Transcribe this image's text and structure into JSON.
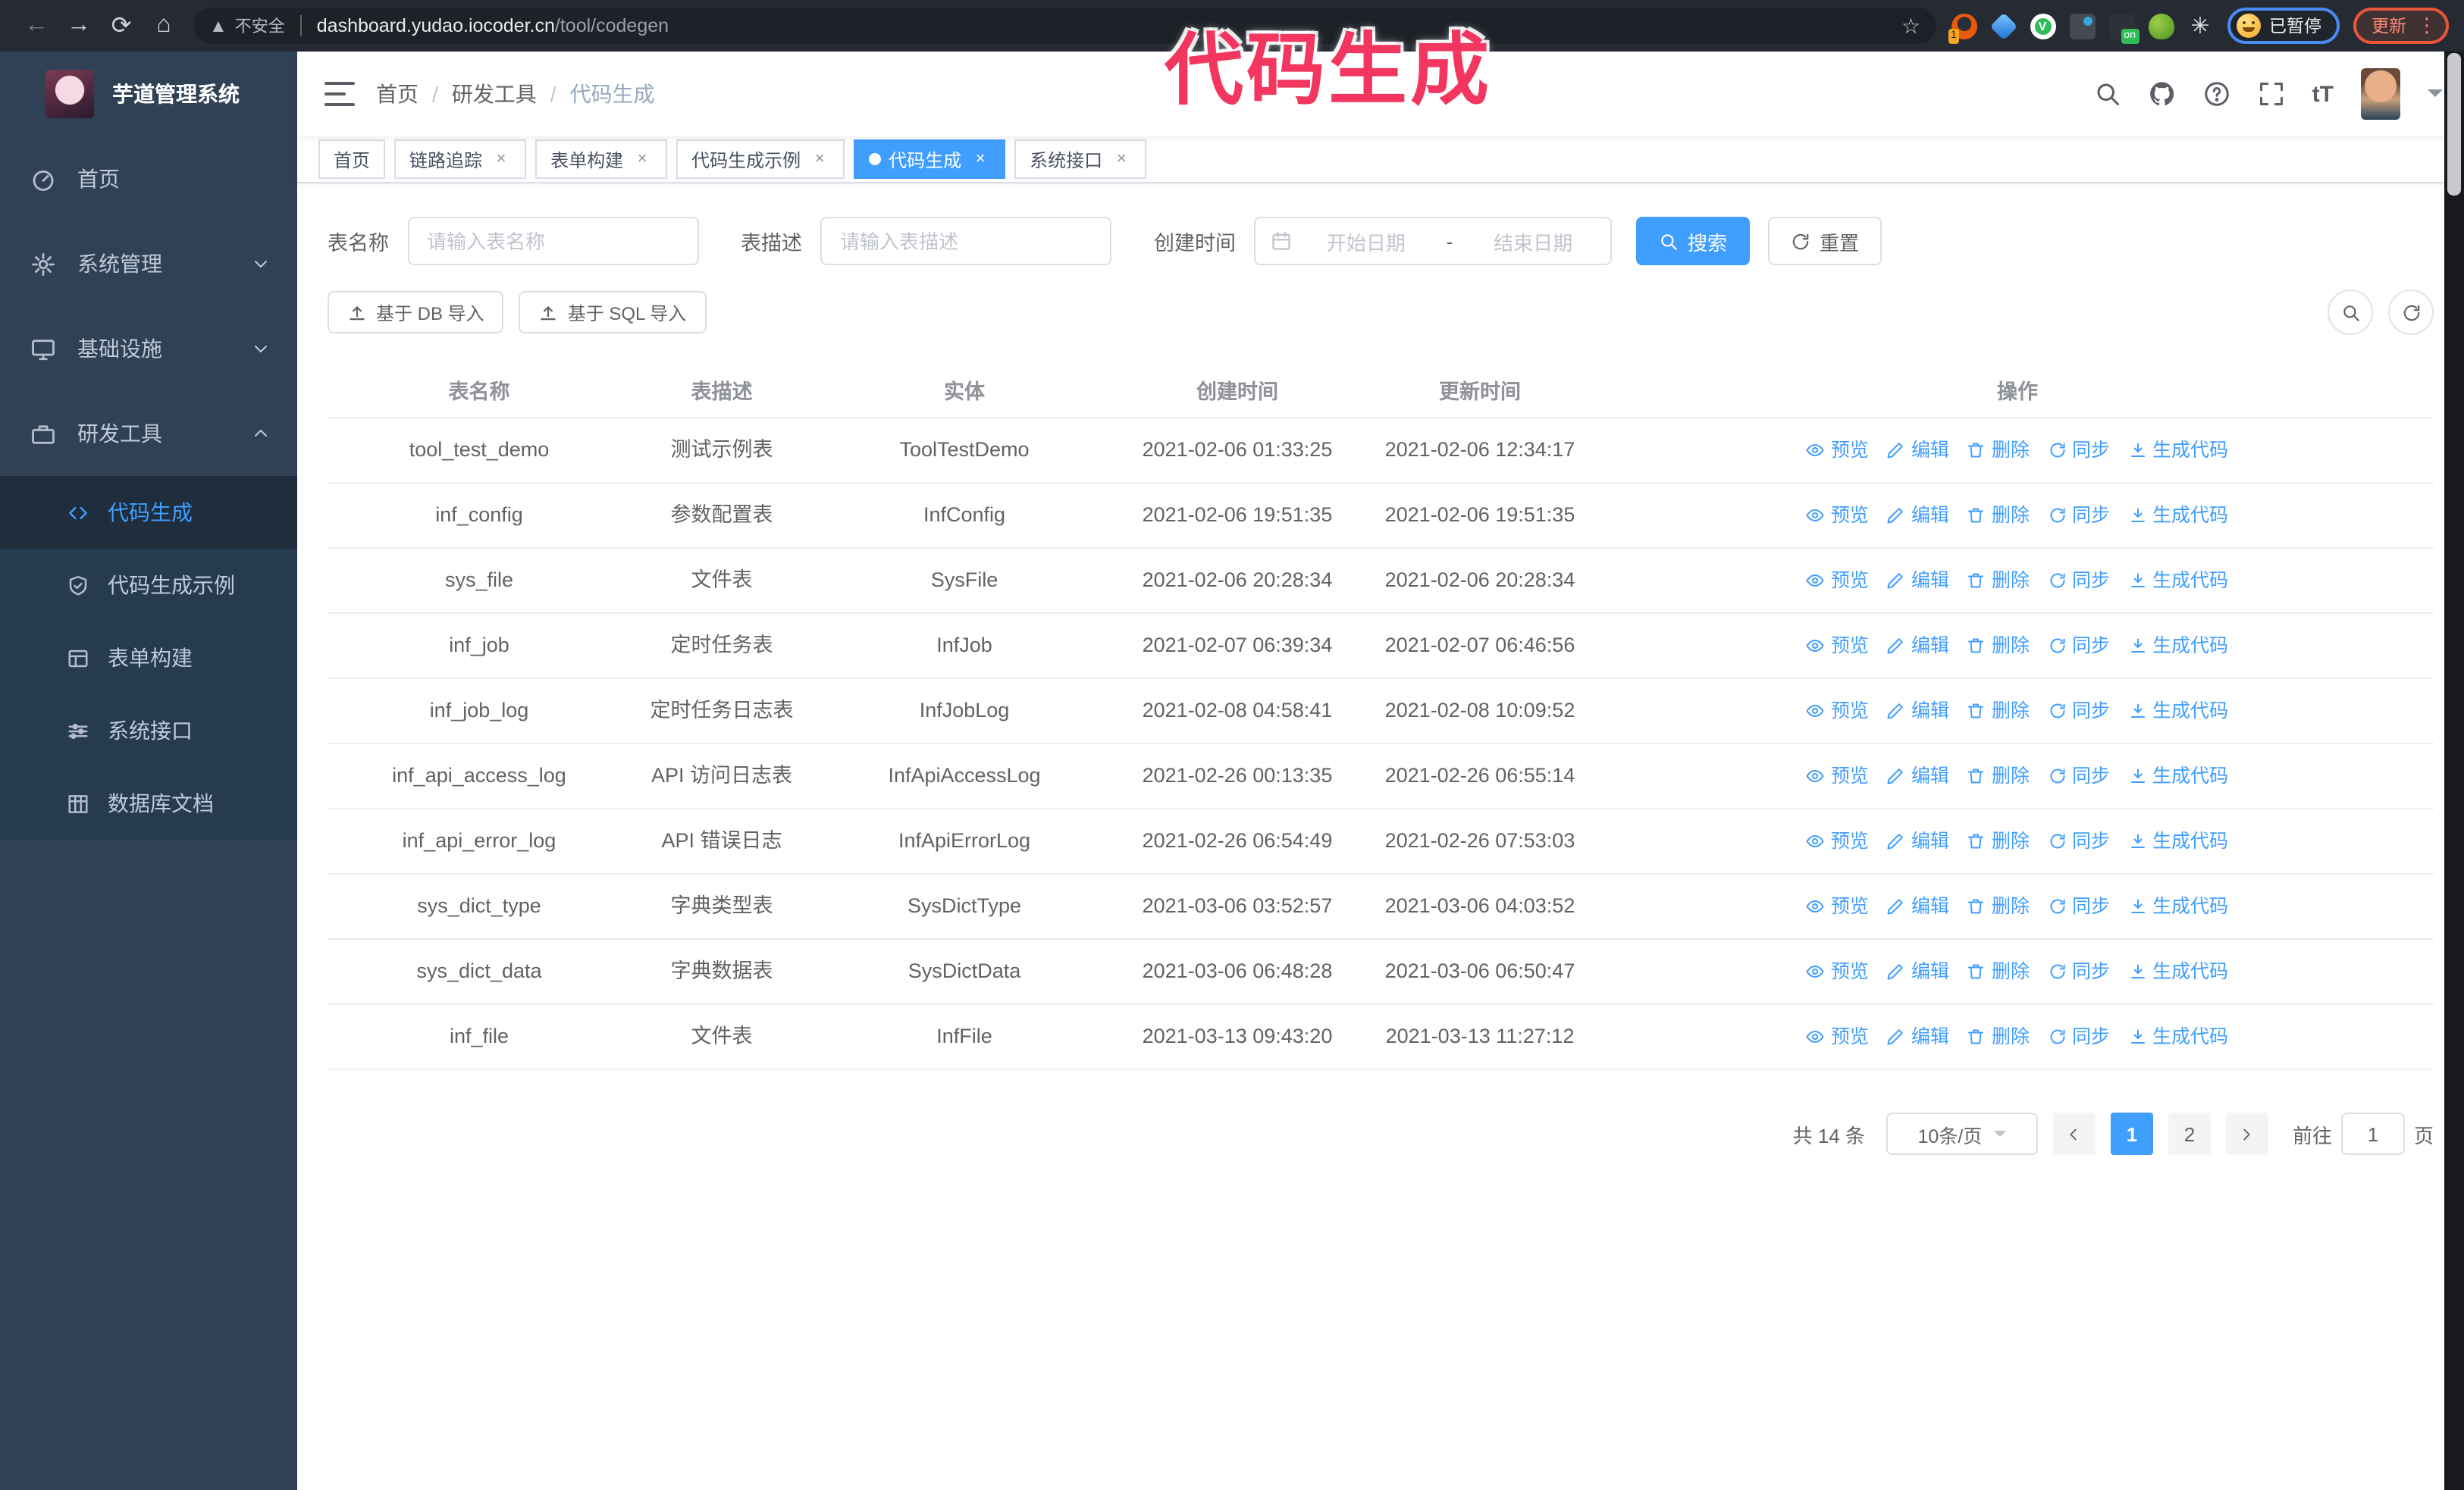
{
  "browser": {
    "security_text": "不安全",
    "url_domain": "dashboard.yudao.iocoder.cn",
    "url_path": "/tool/codegen",
    "ext_badge_count": "1",
    "ext_badge_on": "on",
    "paused_label": "已暂停",
    "update_label": "更新"
  },
  "annotation": {
    "text": "代码生成",
    "color": "#f2365f"
  },
  "sidebar": {
    "title": "芋道管理系统",
    "menu": [
      {
        "label": "首页"
      },
      {
        "label": "系统管理"
      },
      {
        "label": "基础设施"
      },
      {
        "label": "研发工具"
      }
    ],
    "submenu": [
      {
        "label": "代码生成"
      },
      {
        "label": "代码生成示例"
      },
      {
        "label": "表单构建"
      },
      {
        "label": "系统接口"
      },
      {
        "label": "数据库文档"
      }
    ]
  },
  "breadcrumb": {
    "items": [
      "首页",
      "研发工具",
      "代码生成"
    ]
  },
  "tabs": [
    {
      "label": "首页"
    },
    {
      "label": "链路追踪"
    },
    {
      "label": "表单构建"
    },
    {
      "label": "代码生成示例"
    },
    {
      "label": "代码生成"
    },
    {
      "label": "系统接口"
    }
  ],
  "filters": {
    "table_name_label": "表名称",
    "table_name_placeholder": "请输入表名称",
    "table_desc_label": "表描述",
    "table_desc_placeholder": "请输入表描述",
    "create_time_label": "创建时间",
    "start_date_placeholder": "开始日期",
    "range_separator": "-",
    "end_date_placeholder": "结束日期",
    "search_label": "搜索",
    "reset_label": "重置"
  },
  "toolbar": {
    "import_db_label": "基于 DB 导入",
    "import_sql_label": "基于 SQL 导入"
  },
  "table": {
    "columns": [
      "表名称",
      "表描述",
      "实体",
      "创建时间",
      "更新时间",
      "操作"
    ],
    "actions": [
      "预览",
      "编辑",
      "删除",
      "同步",
      "生成代码"
    ],
    "rows": [
      {
        "name": "tool_test_demo",
        "desc": "测试示例表",
        "entity": "ToolTestDemo",
        "created": "2021-02-06 01:33:25",
        "updated": "2021-02-06 12:34:17"
      },
      {
        "name": "inf_config",
        "desc": "参数配置表",
        "entity": "InfConfig",
        "created": "2021-02-06 19:51:35",
        "updated": "2021-02-06 19:51:35"
      },
      {
        "name": "sys_file",
        "desc": "文件表",
        "entity": "SysFile",
        "created": "2021-02-06 20:28:34",
        "updated": "2021-02-06 20:28:34"
      },
      {
        "name": "inf_job",
        "desc": "定时任务表",
        "entity": "InfJob",
        "created": "2021-02-07 06:39:34",
        "updated": "2021-02-07 06:46:56"
      },
      {
        "name": "inf_job_log",
        "desc": "定时任务日志表",
        "entity": "InfJobLog",
        "created": "2021-02-08 04:58:41",
        "updated": "2021-02-08 10:09:52"
      },
      {
        "name": "inf_api_access_log",
        "desc": "API 访问日志表",
        "entity": "InfApiAccessLog",
        "created": "2021-02-26 00:13:35",
        "updated": "2021-02-26 06:55:14"
      },
      {
        "name": "inf_api_error_log",
        "desc": "API 错误日志",
        "entity": "InfApiErrorLog",
        "created": "2021-02-26 06:54:49",
        "updated": "2021-02-26 07:53:03"
      },
      {
        "name": "sys_dict_type",
        "desc": "字典类型表",
        "entity": "SysDictType",
        "created": "2021-03-06 03:52:57",
        "updated": "2021-03-06 04:03:52"
      },
      {
        "name": "sys_dict_data",
        "desc": "字典数据表",
        "entity": "SysDictData",
        "created": "2021-03-06 06:48:28",
        "updated": "2021-03-06 06:50:47"
      },
      {
        "name": "inf_file",
        "desc": "文件表",
        "entity": "InfFile",
        "created": "2021-03-13 09:43:20",
        "updated": "2021-03-13 11:27:12"
      }
    ]
  },
  "pagination": {
    "total_text": "共 14 条",
    "page_size_text": "10条/页",
    "pages": [
      "1",
      "2"
    ],
    "active_page": "1",
    "goto_label": "前往",
    "goto_value": "1",
    "page_unit": "页"
  },
  "colors": {
    "accent": "#409EFF",
    "sidebar_bg": "#304156",
    "submenu_bg": "#263a50",
    "annotation": "#f2365f"
  }
}
